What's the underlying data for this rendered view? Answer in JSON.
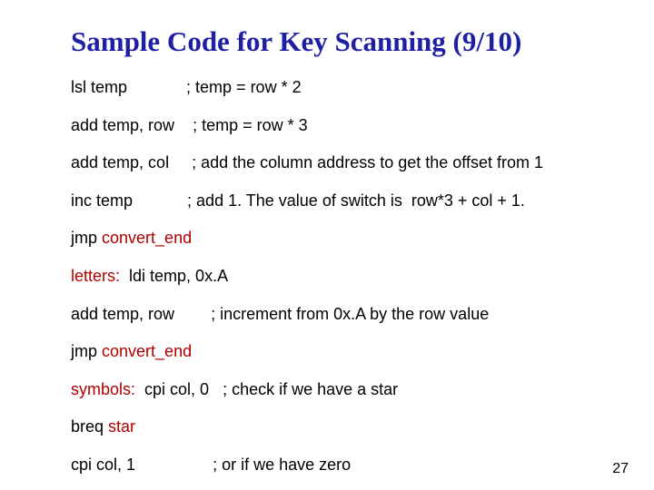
{
  "title": "Sample Code for Key Scanning (9/10)",
  "lines": {
    "l1_instr": "lsl temp",
    "l1_pad": "             ",
    "l1_cmt": "; temp = row * 2",
    "l2_instr": "add temp, row",
    "l2_pad": "    ",
    "l2_cmt": "; temp = row * 3",
    "l3_instr": "add temp, col",
    "l3_pad": "     ",
    "l3_cmt": "; add the column address to get the offset from 1",
    "l4_instr": "inc temp",
    "l4_pad": "            ",
    "l4_cmt": "; add 1. The value of switch is  row*3 + col + 1.",
    "l5_jmp": "jmp ",
    "l5_tgt": "convert_end",
    "l6_label": "letters:",
    "l6_rest": "  ldi temp, 0x.A",
    "l7_instr": "add temp, row",
    "l7_pad": "        ",
    "l7_cmt": "; increment from 0x.A by the row value",
    "l8_jmp": "jmp ",
    "l8_tgt": "convert_end",
    "l9_label": "symbols:",
    "l9_instr": "  cpi col, 0",
    "l9_pad": "   ",
    "l9_cmt": "; check if we have a star",
    "l10_breq": "breq ",
    "l10_tgt": "star",
    "l11_instr": "cpi col, 1",
    "l11_pad": "                 ",
    "l11_cmt": "; or if we have zero"
  },
  "page": "27"
}
